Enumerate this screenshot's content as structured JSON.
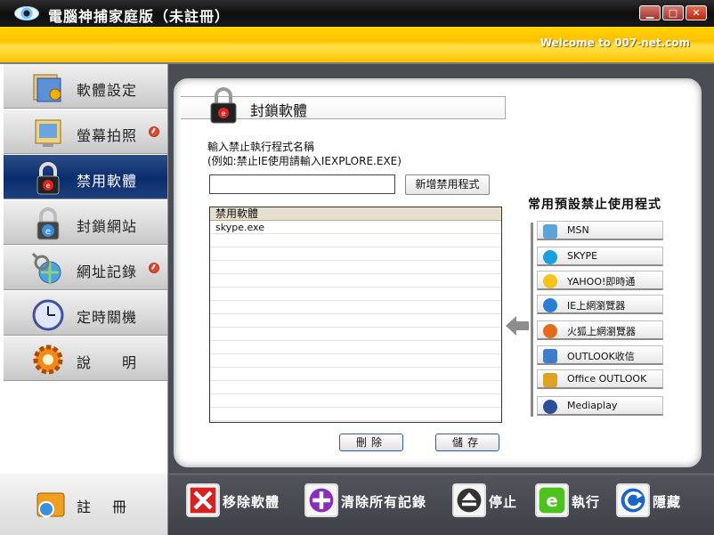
{
  "window": {
    "title": "電腦神捕家庭版（未註冊）",
    "min_label": "▁",
    "max_label": "□",
    "close_label": "✕"
  },
  "banner": {
    "text": "Welcome to 007-net.com"
  },
  "sidebar": {
    "items": [
      {
        "label": "軟體設定",
        "icon": "software-settings-icon"
      },
      {
        "label": "螢幕拍照",
        "icon": "screenshot-icon"
      },
      {
        "label": "禁用軟體",
        "icon": "block-software-lock-icon",
        "active": true
      },
      {
        "label": "封鎖網站",
        "icon": "block-website-lock-icon"
      },
      {
        "label": "網址記錄",
        "icon": "url-log-icon"
      },
      {
        "label": "定時關機",
        "icon": "timer-shutdown-clock-icon"
      },
      {
        "label": "說　　明",
        "icon": "help-gear-icon"
      }
    ]
  },
  "main": {
    "section_title": "封鎖軟體",
    "input_label_1": "輸入禁止執行程式名稱",
    "input_label_2": "(例如:禁止IE使用請輸入IEXPLORE.EXE)",
    "input_value": "",
    "add_button": "新增禁用程式",
    "list_header": "禁用軟體",
    "list_items": [
      "skype.exe"
    ],
    "delete_button": "刪除",
    "save_button": "儲存",
    "presets_title": "常用預設禁止使用程式",
    "presets": [
      {
        "label": "MSN",
        "icon": "msn-icon",
        "color": "#5aa4d8"
      },
      {
        "label": "SKYPE",
        "icon": "skype-icon",
        "color": "#1a9fe0"
      },
      {
        "label": "YAHOO!即時通",
        "icon": "yahoo-smiley-icon",
        "color": "#f4c21a"
      },
      {
        "label": "IE上網瀏覽器",
        "icon": "internet-explorer-icon",
        "color": "#2a7fd4"
      },
      {
        "label": "火狐上網瀏覽器",
        "icon": "firefox-icon",
        "color": "#e66a1c"
      },
      {
        "label": "OUTLOOK收信",
        "icon": "outlook-express-icon",
        "color": "#3a7fc8"
      },
      {
        "label": "Office OUTLOOK",
        "icon": "office-outlook-icon",
        "color": "#e0a020"
      },
      {
        "label": "Mediaplay",
        "icon": "media-player-icon",
        "color": "#2d4f9a"
      }
    ]
  },
  "toolbar": {
    "register": "註冊",
    "remove_software": "移除軟體",
    "clear_logs": "清除所有記錄",
    "stop": "停止",
    "run": "執行",
    "hide": "隱藏"
  }
}
